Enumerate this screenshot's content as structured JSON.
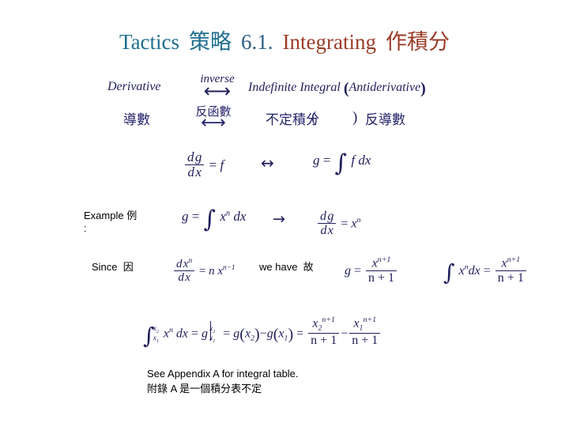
{
  "slide": {
    "background": "#ffffff",
    "title": {
      "tactics": "Tactics",
      "tactics_cjk": "策略",
      "number": "6.1.",
      "integrating": "Integrating",
      "integrating_cjk": "作積分",
      "color_blue": "#1f6f8f",
      "color_blue2": "#2b5f86",
      "color_red": "#9b3b27"
    },
    "relation_row": {
      "left_term": "Derivative",
      "arrow_label": "inverse",
      "arrow_glyph": "⟷",
      "right_term": "Indefinite Integral",
      "right_paren_open": "(",
      "right_term_alt": "Antiderivative",
      "right_paren_close": ")",
      "color": "#1f1f5c"
    },
    "relation_row_cjk": {
      "left_term": "導數",
      "arrow_label": "反函數",
      "arrow_glyph": "⟷",
      "right_term": "不定積分",
      "paren_open": "(",
      "paren_close": ")",
      "right_term_alt": "反導數",
      "color": "#24246b"
    },
    "equivalence_row": {
      "lhs_num_d": "d",
      "lhs_num_g": "g",
      "lhs_den_d": "d",
      "lhs_den_x": "x",
      "lhs_eq": "=",
      "lhs_f": "f",
      "connector": "↔",
      "rhs_g": "g",
      "rhs_eq": "=",
      "rhs_int": "∫",
      "rhs_f": "f",
      "rhs_d": "d",
      "rhs_x": "x"
    },
    "example": {
      "label": "Example",
      "label_cjk": "例",
      "colon": ":",
      "eq_g": "g",
      "eq_equals": "=",
      "eq_int": "∫",
      "eq_x": "x",
      "eq_pow_n": "n",
      "eq_d": "d",
      "eq_dx": "x",
      "arrow": "→",
      "res_num_d": "d",
      "res_num_g": "g",
      "res_den_d": "d",
      "res_den_x": "x",
      "res_equals": "=",
      "res_x": "x",
      "res_pow": "n"
    },
    "since_row": {
      "since_label": "Since",
      "since_cjk": "因",
      "deriv_num_d": "d",
      "deriv_num_x": "x",
      "deriv_num_pow": "n",
      "deriv_den_d": "d",
      "deriv_den_x": "x",
      "equals": "=",
      "rhs_n": "n",
      "rhs_x": "x",
      "rhs_pow": "n−1",
      "wehave_label": "we have",
      "wehave_cjk": "故",
      "g_sym": "g",
      "g_equals": "=",
      "g_num_x": "x",
      "g_num_pow": "n+1",
      "g_den": "n + 1",
      "int_sym": "∫",
      "int_x": "x",
      "int_pow": "n",
      "int_d": "d",
      "int_dx": "x",
      "int_equals": "=",
      "int_num_x": "x",
      "int_num_pow": "n+1",
      "int_den": "n + 1"
    },
    "definite_row": {
      "int_sym": "∫",
      "lim_hi": "x",
      "lim_hi_sub": "2",
      "lim_lo": "x",
      "lim_lo_sub": "1",
      "int_x": "x",
      "int_pow": "n",
      "int_d": "d",
      "int_dx": "x",
      "eq1": "=",
      "g1": "g",
      "bar_hi": "x",
      "bar_hi_sub": "2",
      "bar_lo": "x",
      "bar_lo_sub": "1",
      "eq2": "=",
      "g2": "g",
      "g2_arg": "x",
      "g2_sub": "2",
      "minus": "−",
      "g3": "g",
      "g3_arg": "x",
      "g3_sub": "1",
      "eq3": "=",
      "f1_num_x": "x",
      "f1_num_sub": "2",
      "f1_num_pow": "n+1",
      "f1_den": "n + 1",
      "minus2": "−",
      "f2_num_x": "x",
      "f2_num_sub": "1",
      "f2_num_pow": "n+1",
      "f2_den": "n + 1"
    },
    "footer": {
      "line_en": "See Appendix A for integral table.",
      "line_cjk": "附錄 A 是一個積分表不定"
    }
  }
}
